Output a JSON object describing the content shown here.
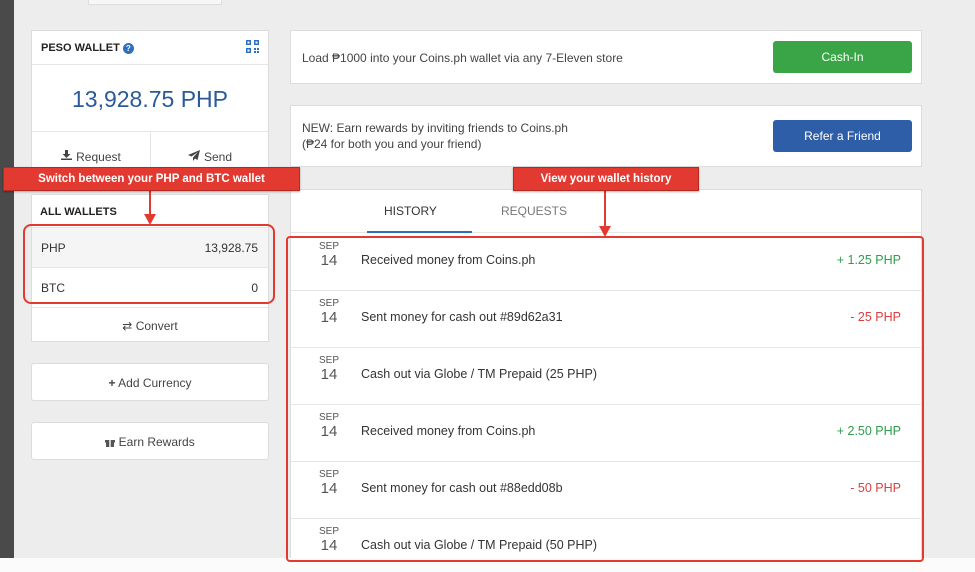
{
  "wallet": {
    "title": "PESO WALLET",
    "balance": "13,928.75 PHP",
    "request_label": "Request",
    "send_label": "Send"
  },
  "all_wallets": {
    "title": "ALL WALLETS",
    "rows": [
      {
        "currency": "PHP",
        "amount": "13,928.75"
      },
      {
        "currency": "BTC",
        "amount": "0"
      }
    ],
    "convert_label": "Convert"
  },
  "side_buttons": {
    "add_currency": "Add Currency",
    "earn_rewards": "Earn Rewards"
  },
  "promos": {
    "cashin_text": "Load ₱1000 into your Coins.ph wallet via any 7-Eleven store",
    "cashin_button": "Cash-In",
    "refer_line1": "NEW: Earn rewards by inviting friends to Coins.ph",
    "refer_line2": "(₱24 for both you and your friend)",
    "refer_button": "Refer a Friend"
  },
  "tabs": {
    "history": "HISTORY",
    "requests": "REQUESTS"
  },
  "transactions": [
    {
      "month": "SEP",
      "day": "14",
      "description": "Received money from Coins.ph",
      "amount": "+ 1.25 PHP",
      "type": "credit"
    },
    {
      "month": "SEP",
      "day": "14",
      "description": "Sent money for cash out #89d62a31",
      "amount": "- 25 PHP",
      "type": "debit"
    },
    {
      "month": "SEP",
      "day": "14",
      "description": "Cash out via Globe / TM Prepaid (25 PHP)",
      "amount": "",
      "type": "none"
    },
    {
      "month": "SEP",
      "day": "14",
      "description": "Received money from Coins.ph",
      "amount": "+ 2.50 PHP",
      "type": "credit"
    },
    {
      "month": "SEP",
      "day": "14",
      "description": "Sent money for cash out #88edd08b",
      "amount": "- 50 PHP",
      "type": "debit"
    },
    {
      "month": "SEP",
      "day": "14",
      "description": "Cash out via Globe / TM Prepaid (50 PHP)",
      "amount": "",
      "type": "none"
    }
  ],
  "annotations": {
    "switch_wallet": "Switch between your PHP and BTC wallet",
    "view_history": "View your wallet history"
  },
  "colors": {
    "accent_blue": "#2f6fbf",
    "balance_blue": "#2b5a9a",
    "cashin_green": "#3aa547",
    "refer_blue": "#2f5ea8",
    "credit_green": "#2e9d4a",
    "debit_red": "#d94040",
    "annotation_red": "#e23a31"
  }
}
